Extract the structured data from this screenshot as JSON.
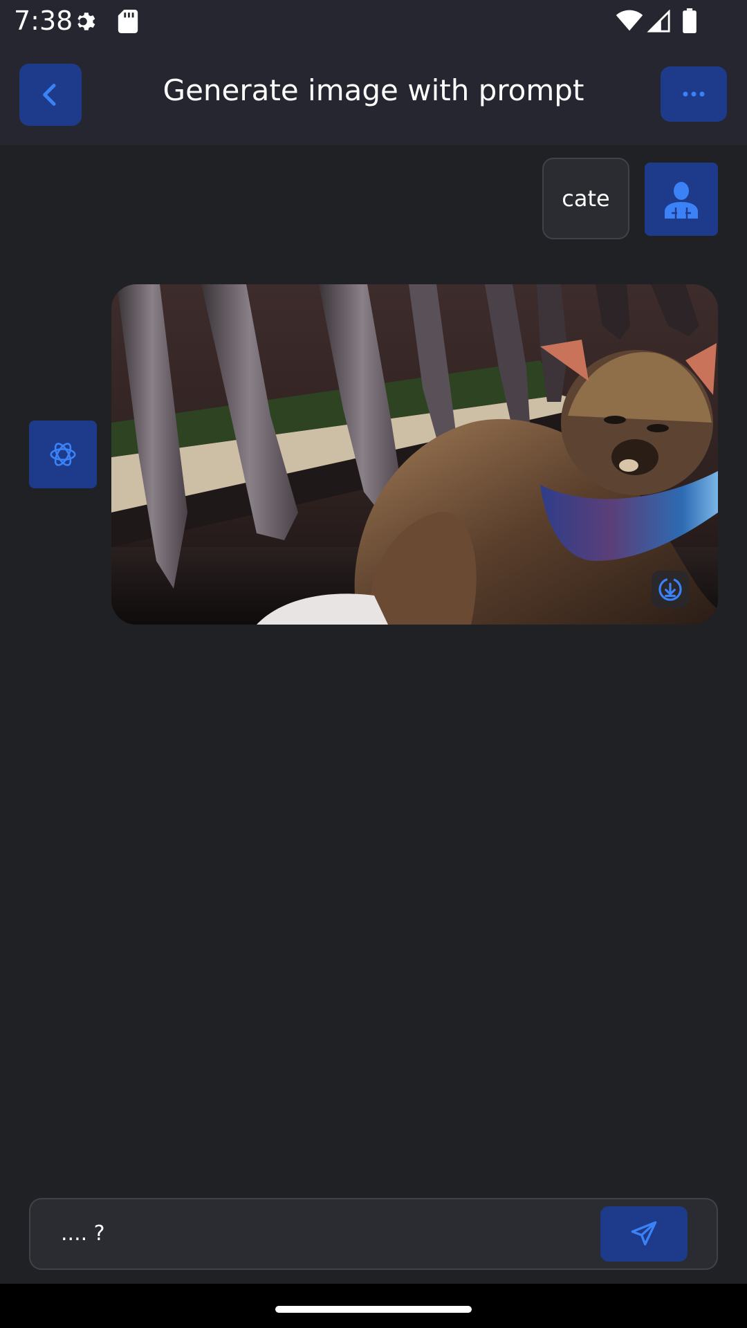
{
  "status_bar": {
    "time": "7:38",
    "icons": [
      "gear-icon",
      "sd-card-icon",
      "wifi-icon",
      "signal-icon",
      "battery-icon"
    ]
  },
  "app_bar": {
    "title": "Generate image with prompt",
    "back_icon": "chevron-left-icon",
    "more_icon": "more-dots-icon"
  },
  "conversation": {
    "user_message": "cate",
    "user_avatar_icon": "user-icon",
    "bot_avatar_icon": "openai-logo-icon",
    "generated_image_description": "photo of a tortoiseshell cat with a colorful scarf",
    "download_icon": "download-icon"
  },
  "composer": {
    "input_value": ".... ?",
    "send_icon": "send-icon"
  },
  "colors": {
    "background": "#202125",
    "header": "#25262f",
    "accent": "#1e3a8a",
    "accent_icon": "#3b82f6"
  }
}
